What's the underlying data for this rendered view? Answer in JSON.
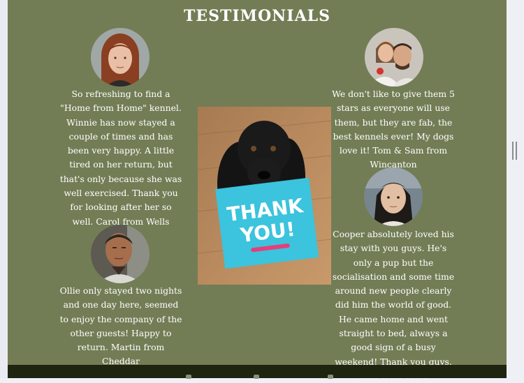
{
  "title": "TESTIMONIALS",
  "testimonials": [
    {
      "text": "So refreshing to find a \"Home from Home\" kennel. Winnie has now stayed a couple of times and has been very happy. A little tired on her return, but that's only because she was well exercised. Thank you for looking after her so well. Carol from Wells",
      "avatar_icon": "woman-portrait"
    },
    {
      "text": "Ollie only stayed two nights and one day here, seemed to enjoy the company of the other guests! Happy to return. Martin from Cheddar",
      "avatar_icon": "elderly-man-portrait"
    },
    {
      "text": "We don't like to give them 5 stars as everyone will use them, but they are fab, the best kennels ever! My dogs love it! Tom & Sam from Wincanton",
      "avatar_icon": "couple-portrait"
    },
    {
      "text": "Cooper absolutely loved his stay with you guys. He's only a pup but the socialisation and some time around new people clearly did him the world of good. He came home and went straight to bed, always a good sign of a busy weekend! Thank you guys. Kate from Mere",
      "avatar_icon": "young-woman-portrait"
    }
  ],
  "center_card": {
    "line1": "THANK",
    "line2": "YOU!"
  },
  "colors": {
    "section_bg": "#727d55",
    "footer_bg": "#1f2410",
    "card": "#3cc3dd"
  }
}
